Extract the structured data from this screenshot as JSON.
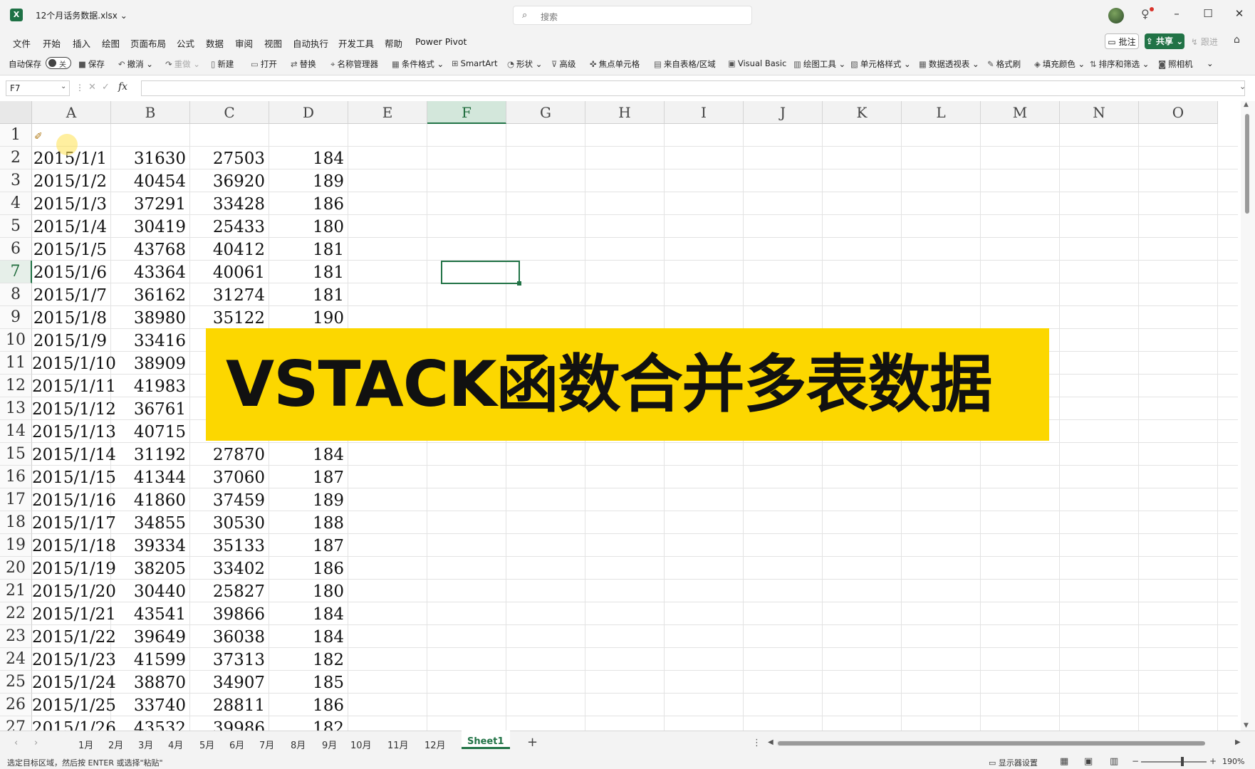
{
  "window": {
    "filename": "12个月话务数据.xlsx",
    "search_placeholder": "搜索",
    "minimize": "–",
    "maximize": "☐",
    "close": "✕"
  },
  "menu": {
    "items": [
      "文件",
      "开始",
      "插入",
      "绘图",
      "页面布局",
      "公式",
      "数据",
      "审阅",
      "视图",
      "自动执行",
      "开发工具",
      "帮助",
      "Power Pivot"
    ],
    "comment": "批注",
    "share": "共享",
    "catch_up": "跟进"
  },
  "ribbon": {
    "autosave": "自动保存",
    "autosave_state": "关",
    "items": [
      "保存",
      "撤消",
      "重做",
      "新建",
      "打开",
      "替换",
      "名称管理器",
      "条件格式",
      "SmartArt",
      "形状",
      "高级",
      "焦点单元格",
      "来自表格/区域",
      "Visual Basic",
      "绘图工具",
      "单元格样式",
      "数据透视表",
      "格式刷",
      "填充颜色",
      "排序和筛选",
      "照相机"
    ]
  },
  "formula_bar": {
    "name_box": "F7",
    "formula": ""
  },
  "grid": {
    "columns": [
      "A",
      "B",
      "C",
      "D",
      "E",
      "F",
      "G",
      "H",
      "I",
      "J",
      "K",
      "L",
      "M",
      "N",
      "O"
    ],
    "selected_column": "F",
    "selected_row": 7,
    "rows": [
      {
        "n": 1,
        "cells": [
          "",
          "",
          "",
          ""
        ]
      },
      {
        "n": 2,
        "cells": [
          "2015/1/1",
          "31630",
          "27503",
          "184"
        ]
      },
      {
        "n": 3,
        "cells": [
          "2015/1/2",
          "40454",
          "36920",
          "189"
        ]
      },
      {
        "n": 4,
        "cells": [
          "2015/1/3",
          "37291",
          "33428",
          "186"
        ]
      },
      {
        "n": 5,
        "cells": [
          "2015/1/4",
          "30419",
          "25433",
          "180"
        ]
      },
      {
        "n": 6,
        "cells": [
          "2015/1/5",
          "43768",
          "40412",
          "181"
        ]
      },
      {
        "n": 7,
        "cells": [
          "2015/1/6",
          "43364",
          "40061",
          "181"
        ]
      },
      {
        "n": 8,
        "cells": [
          "2015/1/7",
          "36162",
          "31274",
          "181"
        ]
      },
      {
        "n": 9,
        "cells": [
          "2015/1/8",
          "38980",
          "35122",
          "190"
        ]
      },
      {
        "n": 10,
        "cells": [
          "2015/1/9",
          "33416",
          "",
          ""
        ]
      },
      {
        "n": 11,
        "cells": [
          "2015/1/10",
          "38909",
          "",
          ""
        ]
      },
      {
        "n": 12,
        "cells": [
          "2015/1/11",
          "41983",
          "",
          ""
        ]
      },
      {
        "n": 13,
        "cells": [
          "2015/1/12",
          "36761",
          "",
          ""
        ]
      },
      {
        "n": 14,
        "cells": [
          "2015/1/13",
          "40715",
          "",
          ""
        ]
      },
      {
        "n": 15,
        "cells": [
          "2015/1/14",
          "31192",
          "27870",
          "184"
        ]
      },
      {
        "n": 16,
        "cells": [
          "2015/1/15",
          "41344",
          "37060",
          "187"
        ]
      },
      {
        "n": 17,
        "cells": [
          "2015/1/16",
          "41860",
          "37459",
          "189"
        ]
      },
      {
        "n": 18,
        "cells": [
          "2015/1/17",
          "34855",
          "30530",
          "188"
        ]
      },
      {
        "n": 19,
        "cells": [
          "2015/1/18",
          "39334",
          "35133",
          "187"
        ]
      },
      {
        "n": 20,
        "cells": [
          "2015/1/19",
          "38205",
          "33402",
          "186"
        ]
      },
      {
        "n": 21,
        "cells": [
          "2015/1/20",
          "30440",
          "25827",
          "180"
        ]
      },
      {
        "n": 22,
        "cells": [
          "2015/1/21",
          "43541",
          "39866",
          "184"
        ]
      },
      {
        "n": 23,
        "cells": [
          "2015/1/22",
          "39649",
          "36038",
          "184"
        ]
      },
      {
        "n": 24,
        "cells": [
          "2015/1/23",
          "41599",
          "37313",
          "182"
        ]
      },
      {
        "n": 25,
        "cells": [
          "2015/1/24",
          "38870",
          "34907",
          "185"
        ]
      },
      {
        "n": 26,
        "cells": [
          "2015/1/25",
          "33740",
          "28811",
          "186"
        ]
      },
      {
        "n": 27,
        "cells": [
          "2015/1/26",
          "43532",
          "39986",
          "182"
        ]
      }
    ]
  },
  "banner": {
    "text": "VSTACK函数合并多表数据",
    "color": "#fcd700"
  },
  "sheets": {
    "tabs": [
      "1月",
      "2月",
      "3月",
      "4月",
      "5月",
      "6月",
      "7月",
      "8月",
      "9月",
      "10月",
      "11月",
      "12月",
      "Sheet1"
    ],
    "active": "Sheet1",
    "add": "+"
  },
  "status": {
    "message": "选定目标区域，然后按 ENTER 或选择\"粘贴\"",
    "display_settings": "显示器设置",
    "zoom": "190%"
  },
  "colors": {
    "accent": "#217346",
    "banner": "#fcd700"
  }
}
